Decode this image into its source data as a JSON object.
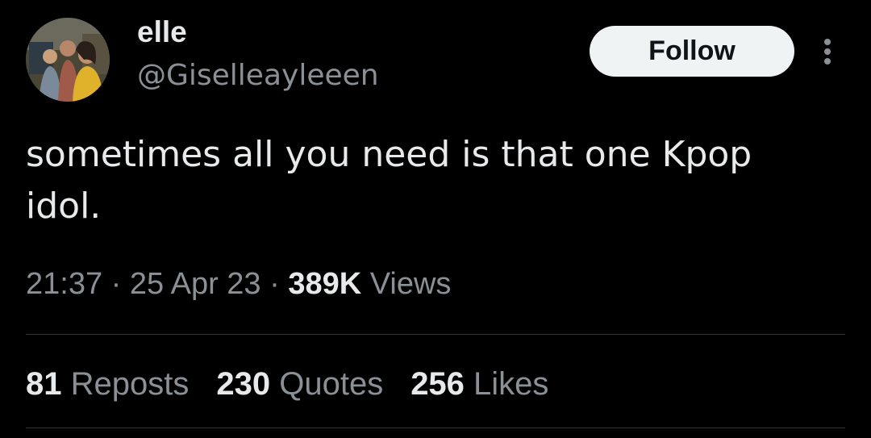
{
  "user": {
    "display_name": "elle",
    "handle": "@Giselleayleeen"
  },
  "header": {
    "follow_label": "Follow",
    "more_icon": "more-vertical-icon"
  },
  "tweet": {
    "text": "sometimes all you need is that one Kpop\nidol."
  },
  "meta": {
    "time": "21:37",
    "sep1": " · ",
    "date": "25 Apr 23",
    "sep2": " · ",
    "views_count": "389K",
    "views_label": " Views"
  },
  "stats": {
    "reposts_count": "81",
    "reposts_label": " Reposts",
    "quotes_count": "230",
    "quotes_label": " Quotes",
    "likes_count": "256",
    "likes_label": " Likes"
  },
  "colors": {
    "background": "#000000",
    "text_primary": "#e7e9ea",
    "text_secondary": "#8b9096",
    "button_bg": "#eff3f4",
    "divider": "#2f3336"
  }
}
